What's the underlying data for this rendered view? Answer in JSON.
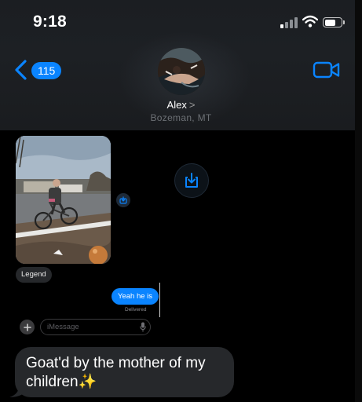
{
  "status_bar": {
    "time": "9:18",
    "icons": [
      "cellular-signal-icon",
      "wifi-icon",
      "battery-icon"
    ]
  },
  "nav": {
    "back_count": "115",
    "back_icon": "chevron-left-icon",
    "video_icon": "video-camera-icon"
  },
  "contact": {
    "name": "Alex",
    "name_chevron": ">",
    "location": "Bozeman, MT"
  },
  "conversation": {
    "photo_message": "bike-photo",
    "tapback_icon": "tapback-icon",
    "save_icon": "save-download-icon",
    "received_reply": "Legend",
    "sent_reply": "Yeah he is",
    "sent_status": "Delivered"
  },
  "composer": {
    "placeholder": "iMessage",
    "plus_icon": "plus-icon",
    "mic_icon": "microphone-icon"
  },
  "preview_message": {
    "text": "Goat'd by the mother of my children✨"
  },
  "colors": {
    "accent": "#0a84ff",
    "received_bubble": "#26282b",
    "background": "#000000"
  }
}
